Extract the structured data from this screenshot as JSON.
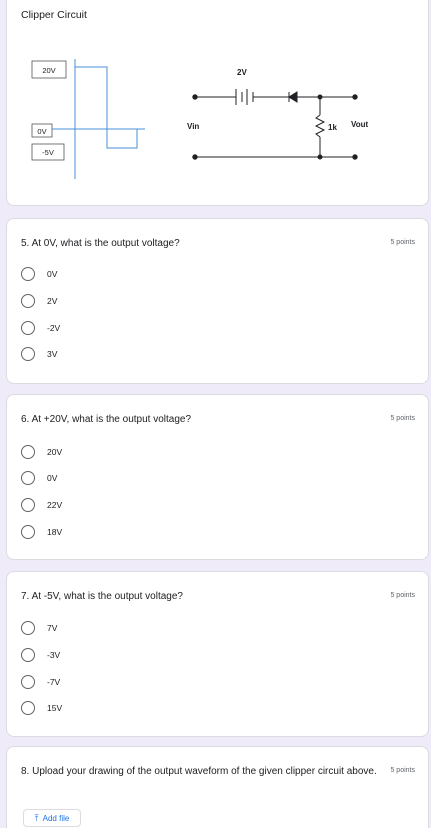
{
  "image_card": {
    "title": "Clipper Circuit",
    "diagram": {
      "levels": [
        "20V",
        "0V",
        "-5V"
      ],
      "battery_label": "2V",
      "input_label": "Vin",
      "output_label": "Vout",
      "resistor_label": "1k"
    }
  },
  "questions": [
    {
      "title": "5. At 0V, what is the output voltage?",
      "points": "5 points",
      "options": [
        "0V",
        "2V",
        "-2V",
        "3V"
      ]
    },
    {
      "title": "6. At +20V, what is the output voltage?",
      "points": "5 points",
      "options": [
        "20V",
        "0V",
        "22V",
        "18V"
      ]
    },
    {
      "title": "7. At -5V, what is the output voltage?",
      "points": "5 points",
      "options": [
        "7V",
        "-3V",
        "-7V",
        "15V"
      ]
    },
    {
      "title": "8. Upload your drawing of the output waveform of the given clipper circuit above.",
      "points": "5 points",
      "add_file_label": "Add file",
      "add_file_icon": "upload-icon"
    }
  ],
  "colors": {
    "page_bg": "#f0ebf8",
    "card_border": "#dadce0",
    "wave_blue": "#4a90d9",
    "link_blue": "#1a73e8"
  }
}
